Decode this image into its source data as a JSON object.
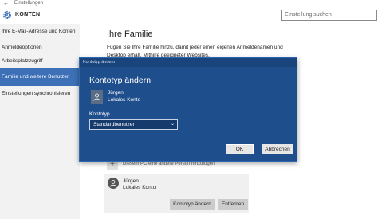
{
  "window": {
    "title": "Einstellungen",
    "back_glyph": "←"
  },
  "header": {
    "title": "KONTEN",
    "icon": "gear-icon"
  },
  "search": {
    "placeholder": "Einstellung suchen"
  },
  "sidebar": {
    "items": [
      {
        "label": "Ihre E-Mail-Adresse und Konten",
        "active": false
      },
      {
        "label": "Anmeldeoptionen",
        "active": false
      },
      {
        "label": "Arbeitsplatzzugriff",
        "active": false
      },
      {
        "label": "Familie und weitere Benutzer",
        "active": true
      },
      {
        "label": "Einstellungen synchronisieren",
        "active": false
      }
    ]
  },
  "main": {
    "title": "Ihre Familie",
    "description": "Fügen Sie Ihre Familie hinzu, damit jeder einen eigenen Anmeldenamen und Desktop erhält. Mithilfe geeigneter Websites,",
    "add_row_text": "Diesem PC eine andere Person hinzufügen",
    "user_card": {
      "name": "Jürgen",
      "type": "Lokales Konto",
      "change_button": "Kontotyp ändern",
      "remove_button": "Entfernen"
    }
  },
  "dialog": {
    "window_title": "Kontotyp ändern",
    "heading": "Kontotyp ändern",
    "user_name": "Jürgen",
    "user_type": "Lokales Konto",
    "field_label": "Kontotyp",
    "selected_value": "Standardbenutzer",
    "ok_label": "OK",
    "cancel_label": "Abbrechen"
  },
  "colors": {
    "accent": "#3d70b6",
    "dialog_bg": "#1f4e8c",
    "sidebar_bg": "#f2f2f2"
  }
}
